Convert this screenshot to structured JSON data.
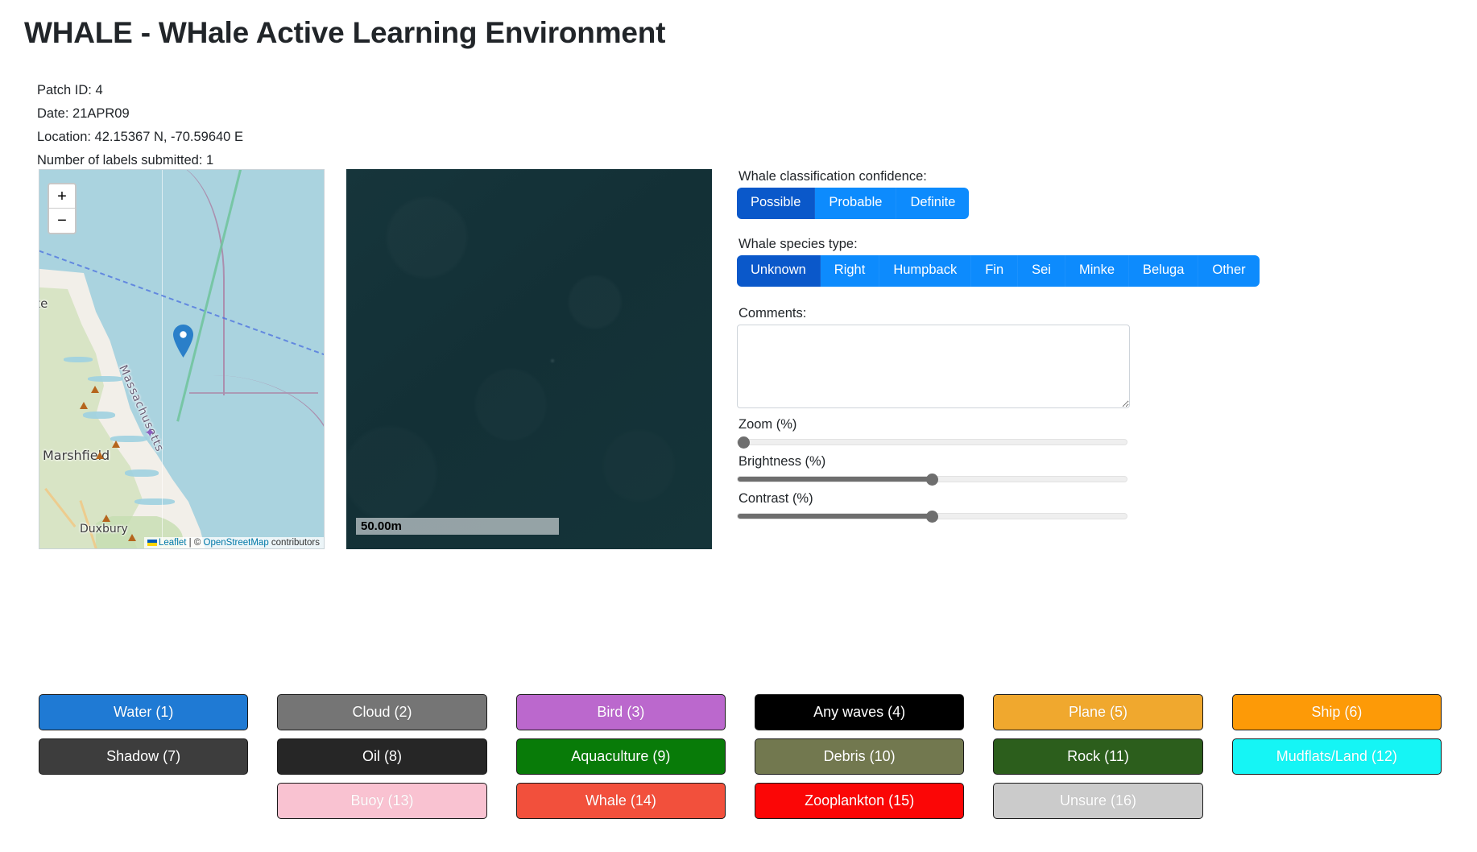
{
  "header": {
    "title": "WHALE - WHale Active Learning Environment"
  },
  "meta": {
    "patch_id": "Patch ID: 4",
    "date": "Date: 21APR09",
    "location": "Location: 42.15367 N, -70.59640 E",
    "labels_submitted": "Number of labels submitted: 1"
  },
  "map": {
    "zoom_in": "+",
    "zoom_out": "−",
    "attrib_leaflet": "Leaflet",
    "attrib_sep": " | © ",
    "attrib_osm": "OpenStreetMap",
    "attrib_tail": " contributors",
    "labels": {
      "scituate": "ate",
      "state": "Massachusetts",
      "marshfield": "Marshfield",
      "duxbury": "Duxbury"
    }
  },
  "patch": {
    "scale_text": "50.00m",
    "background_color": "#153238"
  },
  "controls": {
    "confidence_label": "Whale classification confidence:",
    "confidence_options": [
      {
        "label": "Possible",
        "active": true
      },
      {
        "label": "Probable",
        "active": false
      },
      {
        "label": "Definite",
        "active": false
      }
    ],
    "species_label": "Whale species type:",
    "species_options": [
      {
        "label": "Unknown",
        "active": true
      },
      {
        "label": "Right",
        "active": false
      },
      {
        "label": "Humpback",
        "active": false
      },
      {
        "label": "Fin",
        "active": false
      },
      {
        "label": "Sei",
        "active": false
      },
      {
        "label": "Minke",
        "active": false
      },
      {
        "label": "Beluga",
        "active": false
      },
      {
        "label": "Other",
        "active": false
      }
    ],
    "comments_label": "Comments:",
    "comments_value": "",
    "comments_placeholder": "",
    "sliders": [
      {
        "label": "Zoom (%)",
        "value": 0,
        "min": 0,
        "max": 100
      },
      {
        "label": "Brightness (%)",
        "value": 50,
        "min": 0,
        "max": 100
      },
      {
        "label": "Contrast (%)",
        "value": 50,
        "min": 0,
        "max": 100
      }
    ],
    "accent_active": "#0a58ca",
    "accent_inactive": "#0d8bfd"
  },
  "label_buttons": {
    "columns": [
      [
        {
          "label": "Water (1)",
          "bg": "#1f7ad4",
          "fg": "#ffffff"
        },
        {
          "label": "Shadow (7)",
          "bg": "#3d3d3d",
          "fg": "#ffffff"
        }
      ],
      [
        {
          "label": "Cloud (2)",
          "bg": "#757575",
          "fg": "#ffffff"
        },
        {
          "label": "Oil (8)",
          "bg": "#262626",
          "fg": "#ffffff"
        },
        {
          "label": "Buoy (13)",
          "bg": "#f9c2d1",
          "fg": "#ffffff"
        }
      ],
      [
        {
          "label": "Bird (3)",
          "bg": "#bb68cd",
          "fg": "#ffffff"
        },
        {
          "label": "Aquaculture (9)",
          "bg": "#087b08",
          "fg": "#ffffff"
        },
        {
          "label": "Whale (14)",
          "bg": "#f2503c",
          "fg": "#ffffff"
        }
      ],
      [
        {
          "label": "Any waves (4)",
          "bg": "#000000",
          "fg": "#ffffff"
        },
        {
          "label": "Debris (10)",
          "bg": "#72784f",
          "fg": "#ffffff"
        },
        {
          "label": "Zooplankton (15)",
          "bg": "#fb0606",
          "fg": "#ffffff"
        }
      ],
      [
        {
          "label": "Plane (5)",
          "bg": "#f0a82e",
          "fg": "#ffffff"
        },
        {
          "label": "Rock (11)",
          "bg": "#2c5e1c",
          "fg": "#ffffff"
        },
        {
          "label": "Unsure (16)",
          "bg": "#cbcbcb",
          "fg": "#ffffff"
        }
      ],
      [
        {
          "label": "Ship (6)",
          "bg": "#fd9a07",
          "fg": "#ffffff"
        },
        {
          "label": "Mudflats/Land (12)",
          "bg": "#15f5f5",
          "fg": "#ffffff"
        }
      ]
    ]
  }
}
